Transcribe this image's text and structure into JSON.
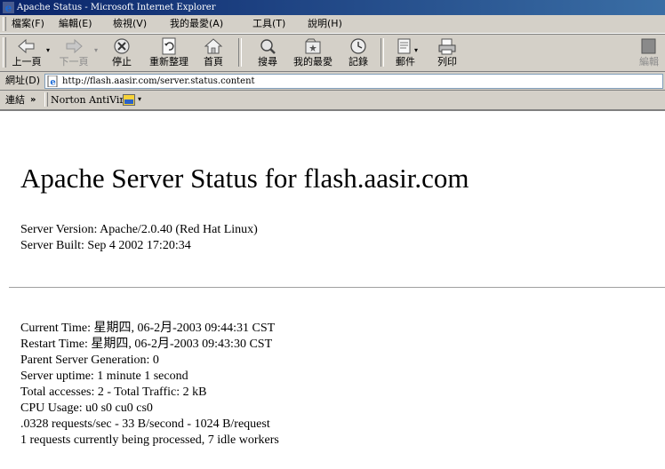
{
  "window": {
    "title": "Apache Status - Microsoft Internet Explorer"
  },
  "menu": {
    "items": [
      "檔案(F)",
      "編輯(E)",
      "檢視(V)",
      "我的最愛(A)",
      "工具(T)",
      "說明(H)"
    ]
  },
  "toolbar": {
    "back": "上一頁",
    "forward": "下一頁",
    "stop": "停止",
    "refresh": "重新整理",
    "home": "首頁",
    "search": "搜尋",
    "favorites": "我的最愛",
    "history": "記錄",
    "mail": "郵件",
    "print": "列印",
    "edit": "編輯"
  },
  "address": {
    "label": "網址(D)",
    "url": "http://flash.aasir.com/server.status.content"
  },
  "links": {
    "label": "連結",
    "chevron": "»",
    "item": "Norton AntiVirus"
  },
  "page": {
    "heading": "Apache Server Status for flash.aasir.com",
    "server_version": "Server Version: Apache/2.0.40 (Red Hat Linux)",
    "server_built": "Server Built: Sep 4 2002 17:20:34",
    "current_time": "Current Time: 星期四, 06-2月-2003 09:44:31 CST",
    "restart_time": "Restart Time: 星期四, 06-2月-2003 09:43:30 CST",
    "parent_generation": "Parent Server Generation: 0",
    "uptime": "Server uptime: 1 minute 1 second",
    "accesses": "Total accesses: 2 - Total Traffic: 2 kB",
    "cpu": "CPU Usage: u0 s0 cu0 cs0",
    "rates": ".0328 requests/sec - 33 B/second - 1024 B/request",
    "workers": "1 requests currently being processed, 7 idle workers"
  }
}
